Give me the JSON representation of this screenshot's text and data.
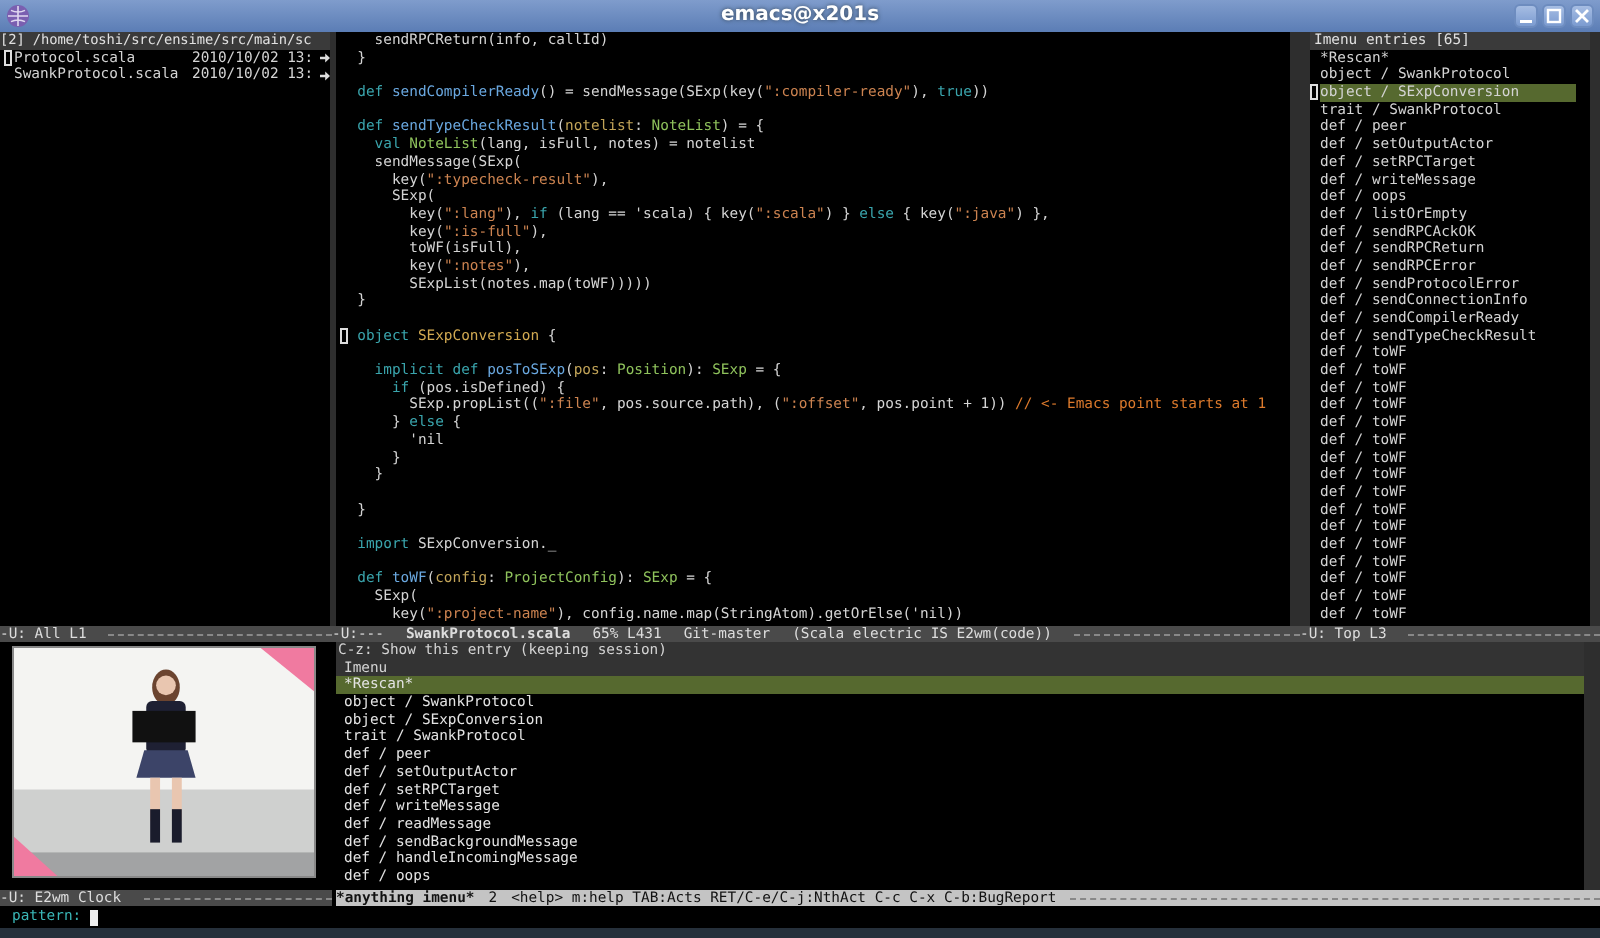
{
  "window": {
    "title": "emacs@x201s"
  },
  "dired": {
    "header": "[2] /home/toshi/src/ensime/src/main/sc",
    "files": [
      {
        "name": "Protocol.scala",
        "date": "2010/10/02 13:",
        "cursor": true
      },
      {
        "name": "SwankProtocol.scala",
        "date": "2010/10/02 13:",
        "cursor": false
      }
    ],
    "mode_line": "-U: All L1"
  },
  "code": {
    "lines": [
      {
        "cursor": false,
        "tokens": [
          {
            "kind": "plain",
            "text": "    sendRPCReturn(info, callId)"
          }
        ]
      },
      {
        "cursor": false,
        "tokens": [
          {
            "kind": "plain",
            "text": "  }"
          }
        ]
      },
      {
        "cursor": false
      },
      {
        "cursor": false,
        "tokens": [
          {
            "kind": "keyword",
            "text": "  def "
          },
          {
            "kind": "func",
            "text": "sendCompilerReady"
          },
          {
            "kind": "plain",
            "text": "() = sendMessage(SExp(key("
          },
          {
            "kind": "string",
            "text": "\":compiler-ready\""
          },
          {
            "kind": "plain",
            "text": "), "
          },
          {
            "kind": "keyword",
            "text": "true"
          },
          {
            "kind": "plain",
            "text": "))"
          }
        ]
      },
      {
        "cursor": false
      },
      {
        "cursor": false,
        "tokens": [
          {
            "kind": "keyword",
            "text": "  def "
          },
          {
            "kind": "func",
            "text": "sendTypeCheckResult"
          },
          {
            "kind": "plain",
            "text": "("
          },
          {
            "kind": "param",
            "text": "notelist"
          },
          {
            "kind": "plain",
            "text": ": "
          },
          {
            "kind": "type",
            "text": "NoteList"
          },
          {
            "kind": "plain",
            "text": ") = {"
          }
        ]
      },
      {
        "cursor": false,
        "tokens": [
          {
            "kind": "keyword",
            "text": "    val "
          },
          {
            "kind": "type",
            "text": "NoteList"
          },
          {
            "kind": "plain",
            "text": "(lang, isFull, notes) = notelist"
          }
        ]
      },
      {
        "cursor": false,
        "tokens": [
          {
            "kind": "plain",
            "text": "    sendMessage(SExp("
          }
        ]
      },
      {
        "cursor": false,
        "tokens": [
          {
            "kind": "plain",
            "text": "      key("
          },
          {
            "kind": "string",
            "text": "\":typecheck-result\""
          },
          {
            "kind": "plain",
            "text": "),"
          }
        ]
      },
      {
        "cursor": false,
        "tokens": [
          {
            "kind": "plain",
            "text": "      SExp("
          }
        ]
      },
      {
        "cursor": false,
        "tokens": [
          {
            "kind": "plain",
            "text": "        key("
          },
          {
            "kind": "string",
            "text": "\":lang\""
          },
          {
            "kind": "plain",
            "text": "), "
          },
          {
            "kind": "keyword",
            "text": "if"
          },
          {
            "kind": "plain",
            "text": " (lang == 'scala) { key("
          },
          {
            "kind": "string",
            "text": "\":scala\""
          },
          {
            "kind": "plain",
            "text": ") } "
          },
          {
            "kind": "keyword",
            "text": "else"
          },
          {
            "kind": "plain",
            "text": " { key("
          },
          {
            "kind": "string",
            "text": "\":java\""
          },
          {
            "kind": "plain",
            "text": ") },"
          }
        ]
      },
      {
        "cursor": false,
        "tokens": [
          {
            "kind": "plain",
            "text": "        key("
          },
          {
            "kind": "string",
            "text": "\":is-full\""
          },
          {
            "kind": "plain",
            "text": "),"
          }
        ]
      },
      {
        "cursor": false,
        "tokens": [
          {
            "kind": "plain",
            "text": "        toWF(isFull),"
          }
        ]
      },
      {
        "cursor": false,
        "tokens": [
          {
            "kind": "plain",
            "text": "        key("
          },
          {
            "kind": "string",
            "text": "\":notes\""
          },
          {
            "kind": "plain",
            "text": "),"
          }
        ]
      },
      {
        "cursor": false,
        "tokens": [
          {
            "kind": "plain",
            "text": "        SExpList(notes.map(toWF)))))"
          }
        ]
      },
      {
        "cursor": false,
        "tokens": [
          {
            "kind": "plain",
            "text": "  }"
          }
        ]
      },
      {
        "cursor": false
      },
      {
        "cursor": true,
        "tokens": [
          {
            "kind": "keyword",
            "text": "  object "
          },
          {
            "kind": "name",
            "text": "SExpConversion"
          },
          {
            "kind": "plain",
            "text": " {"
          }
        ]
      },
      {
        "cursor": false
      },
      {
        "cursor": false,
        "tokens": [
          {
            "kind": "keyword",
            "text": "    implicit def "
          },
          {
            "kind": "func",
            "text": "posToSExp"
          },
          {
            "kind": "plain",
            "text": "("
          },
          {
            "kind": "param",
            "text": "pos"
          },
          {
            "kind": "plain",
            "text": ": "
          },
          {
            "kind": "type",
            "text": "Position"
          },
          {
            "kind": "plain",
            "text": "): "
          },
          {
            "kind": "type",
            "text": "SExp"
          },
          {
            "kind": "plain",
            "text": " = {"
          }
        ]
      },
      {
        "cursor": false,
        "tokens": [
          {
            "kind": "keyword",
            "text": "      if"
          },
          {
            "kind": "plain",
            "text": " (pos.isDefined) {"
          }
        ]
      },
      {
        "cursor": false,
        "tokens": [
          {
            "kind": "plain",
            "text": "        SExp.propList(("
          },
          {
            "kind": "string",
            "text": "\":file\""
          },
          {
            "kind": "plain",
            "text": ", pos.source.path), ("
          },
          {
            "kind": "string",
            "text": "\":offset\""
          },
          {
            "kind": "plain",
            "text": ", pos.point + 1)) "
          },
          {
            "kind": "comment",
            "text": "// <- Emacs point starts at 1"
          }
        ]
      },
      {
        "cursor": false,
        "tokens": [
          {
            "kind": "plain",
            "text": "      } "
          },
          {
            "kind": "keyword",
            "text": "else"
          },
          {
            "kind": "plain",
            "text": " {"
          }
        ]
      },
      {
        "cursor": false,
        "tokens": [
          {
            "kind": "plain",
            "text": "        'nil"
          }
        ]
      },
      {
        "cursor": false,
        "tokens": [
          {
            "kind": "plain",
            "text": "      }"
          }
        ]
      },
      {
        "cursor": false,
        "tokens": [
          {
            "kind": "plain",
            "text": "    }"
          }
        ]
      },
      {
        "cursor": false
      },
      {
        "cursor": false,
        "tokens": [
          {
            "kind": "plain",
            "text": "  }"
          }
        ]
      },
      {
        "cursor": false
      },
      {
        "cursor": false,
        "tokens": [
          {
            "kind": "keyword",
            "text": "  import "
          },
          {
            "kind": "plain",
            "text": "SExpConversion._"
          }
        ]
      },
      {
        "cursor": false
      },
      {
        "cursor": false,
        "tokens": [
          {
            "kind": "keyword",
            "text": "  def "
          },
          {
            "kind": "func",
            "text": "toWF"
          },
          {
            "kind": "plain",
            "text": "("
          },
          {
            "kind": "param",
            "text": "config"
          },
          {
            "kind": "plain",
            "text": ": "
          },
          {
            "kind": "type",
            "text": "ProjectConfig"
          },
          {
            "kind": "plain",
            "text": "): "
          },
          {
            "kind": "type",
            "text": "SExp"
          },
          {
            "kind": "plain",
            "text": " = {"
          }
        ]
      },
      {
        "cursor": false,
        "tokens": [
          {
            "kind": "plain",
            "text": "    SExp("
          }
        ]
      },
      {
        "cursor": false,
        "tokens": [
          {
            "kind": "plain",
            "text": "      key("
          },
          {
            "kind": "string",
            "text": "\":project-name\""
          },
          {
            "kind": "plain",
            "text": "), config.name.map(StringAtom).getOrElse('nil))"
          }
        ]
      }
    ],
    "mode_line": {
      "prefix": "-U:---",
      "buffer": "SwankProtocol.scala",
      "position": "65% L431",
      "branch": "Git-master",
      "modes": "(Scala electric IS E2wm(code))"
    }
  },
  "imenu": {
    "header": "Imenu entries [65]",
    "entries": [
      {
        "label": "*Rescan*",
        "selected": false
      },
      {
        "label": "object / SwankProtocol",
        "selected": false
      },
      {
        "label": "object / SExpConversion",
        "selected": true
      },
      {
        "label": "trait / SwankProtocol",
        "selected": false
      },
      {
        "label": "def / peer",
        "selected": false
      },
      {
        "label": "def / setOutputActor",
        "selected": false
      },
      {
        "label": "def / setRPCTarget",
        "selected": false
      },
      {
        "label": "def / writeMessage",
        "selected": false
      },
      {
        "label": "def / oops",
        "selected": false
      },
      {
        "label": "def / listOrEmpty",
        "selected": false
      },
      {
        "label": "def / sendRPCAckOK",
        "selected": false
      },
      {
        "label": "def / sendRPCReturn",
        "selected": false
      },
      {
        "label": "def / sendRPCError",
        "selected": false
      },
      {
        "label": "def / sendProtocolError",
        "selected": false
      },
      {
        "label": "def / sendConnectionInfo",
        "selected": false
      },
      {
        "label": "def / sendCompilerReady",
        "selected": false
      },
      {
        "label": "def / sendTypeCheckResult",
        "selected": false
      },
      {
        "label": "def / toWF",
        "selected": false
      },
      {
        "label": "def / toWF",
        "selected": false
      },
      {
        "label": "def / toWF",
        "selected": false
      },
      {
        "label": "def / toWF",
        "selected": false
      },
      {
        "label": "def / toWF",
        "selected": false
      },
      {
        "label": "def / toWF",
        "selected": false
      },
      {
        "label": "def / toWF",
        "selected": false
      },
      {
        "label": "def / toWF",
        "selected": false
      },
      {
        "label": "def / toWF",
        "selected": false
      },
      {
        "label": "def / toWF",
        "selected": false
      },
      {
        "label": "def / toWF",
        "selected": false
      },
      {
        "label": "def / toWF",
        "selected": false
      },
      {
        "label": "def / toWF",
        "selected": false
      },
      {
        "label": "def / toWF",
        "selected": false
      },
      {
        "label": "def / toWF",
        "selected": false
      },
      {
        "label": "def / toWF",
        "selected": false
      }
    ],
    "mode_line": "-U: Top L3"
  },
  "clock": {
    "mode_line": "-U: E2wm Clock"
  },
  "anything": {
    "hint": "C-z: Show this entry (keeping session)",
    "source": "Imenu",
    "candidates": [
      {
        "label": "*Rescan*",
        "selected": true
      },
      {
        "label": "object / SwankProtocol",
        "selected": false
      },
      {
        "label": "object / SExpConversion",
        "selected": false
      },
      {
        "label": "trait / SwankProtocol",
        "selected": false
      },
      {
        "label": "def / peer",
        "selected": false
      },
      {
        "label": "def / setOutputActor",
        "selected": false
      },
      {
        "label": "def / setRPCTarget",
        "selected": false
      },
      {
        "label": "def / writeMessage",
        "selected": false
      },
      {
        "label": "def / readMessage",
        "selected": false
      },
      {
        "label": "def / sendBackgroundMessage",
        "selected": false
      },
      {
        "label": "def / handleIncomingMessage",
        "selected": false
      },
      {
        "label": "def / oops",
        "selected": false
      }
    ],
    "mode_line": {
      "buffer": "*anything imenu*",
      "count": "2",
      "help": "<help> m:help TAB:Acts RET/C-e/C-j:NthAct C-c C-x C-b:BugReport"
    }
  },
  "minibuffer": {
    "prompt": "pattern:"
  }
}
